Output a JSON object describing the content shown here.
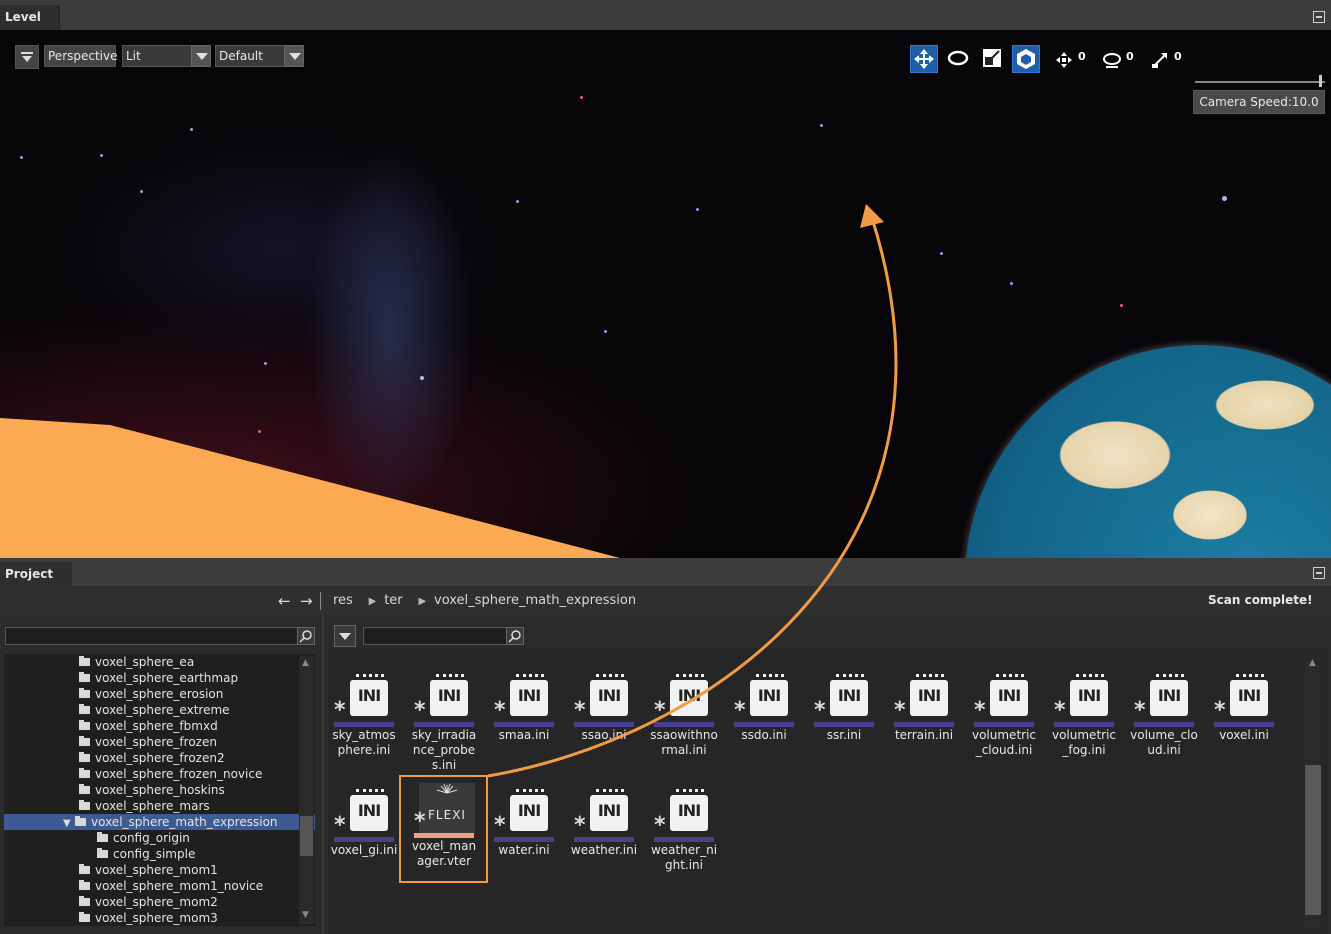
{
  "level_panel": {
    "tab_label": "Level"
  },
  "viewport": {
    "toolbar": {
      "perspective_label": "Perspective",
      "lit_label": "Lit",
      "default_label": "Default"
    },
    "counters": [
      "0",
      "0",
      "0"
    ],
    "camera_speed_label": "Camera Speed:10.0"
  },
  "project_panel": {
    "tab_label": "Project",
    "breadcrumb": [
      "res",
      "ter",
      "voxel_sphere_math_expression"
    ],
    "scan_status": "Scan complete!"
  },
  "tree": {
    "items": [
      "voxel_sphere_ea",
      "voxel_sphere_earthmap",
      "voxel_sphere_erosion",
      "voxel_sphere_extreme",
      "voxel_sphere_fbmxd",
      "voxel_sphere_frozen",
      "voxel_sphere_frozen2",
      "voxel_sphere_frozen_novice",
      "voxel_sphere_hoskins",
      "voxel_sphere_mars",
      "voxel_sphere_math_expression",
      "config_origin",
      "config_simple",
      "voxel_sphere_mom1",
      "voxel_sphere_mom1_novice",
      "voxel_sphere_mom2",
      "voxel_sphere_mom3"
    ]
  },
  "files": {
    "row1": [
      "sky_atmosphere.ini",
      "sky_irradiance_probes.ini",
      "smaa.ini",
      "ssao.ini",
      "ssaowithnormal.ini",
      "ssdo.ini",
      "ssr.ini",
      "terrain.ini",
      "volumetric_cloud.ini",
      "volumetric_fog.ini",
      "volume_cloud.ini",
      "voxel.ini"
    ],
    "row2": [
      "voxel_gi.ini",
      "voxel_manager.vter",
      "water.ini",
      "weather.ini",
      "weather_night.ini"
    ],
    "icon_text_ini": "INI",
    "icon_text_flexi": "FLEXI"
  },
  "colors": {
    "accent_highlight": "#f29b45",
    "selection": "#3d5b92",
    "active_tool": "#1f5fa8",
    "ini_bar": "#4a3f8e",
    "vter_bar": "#f0a080"
  }
}
